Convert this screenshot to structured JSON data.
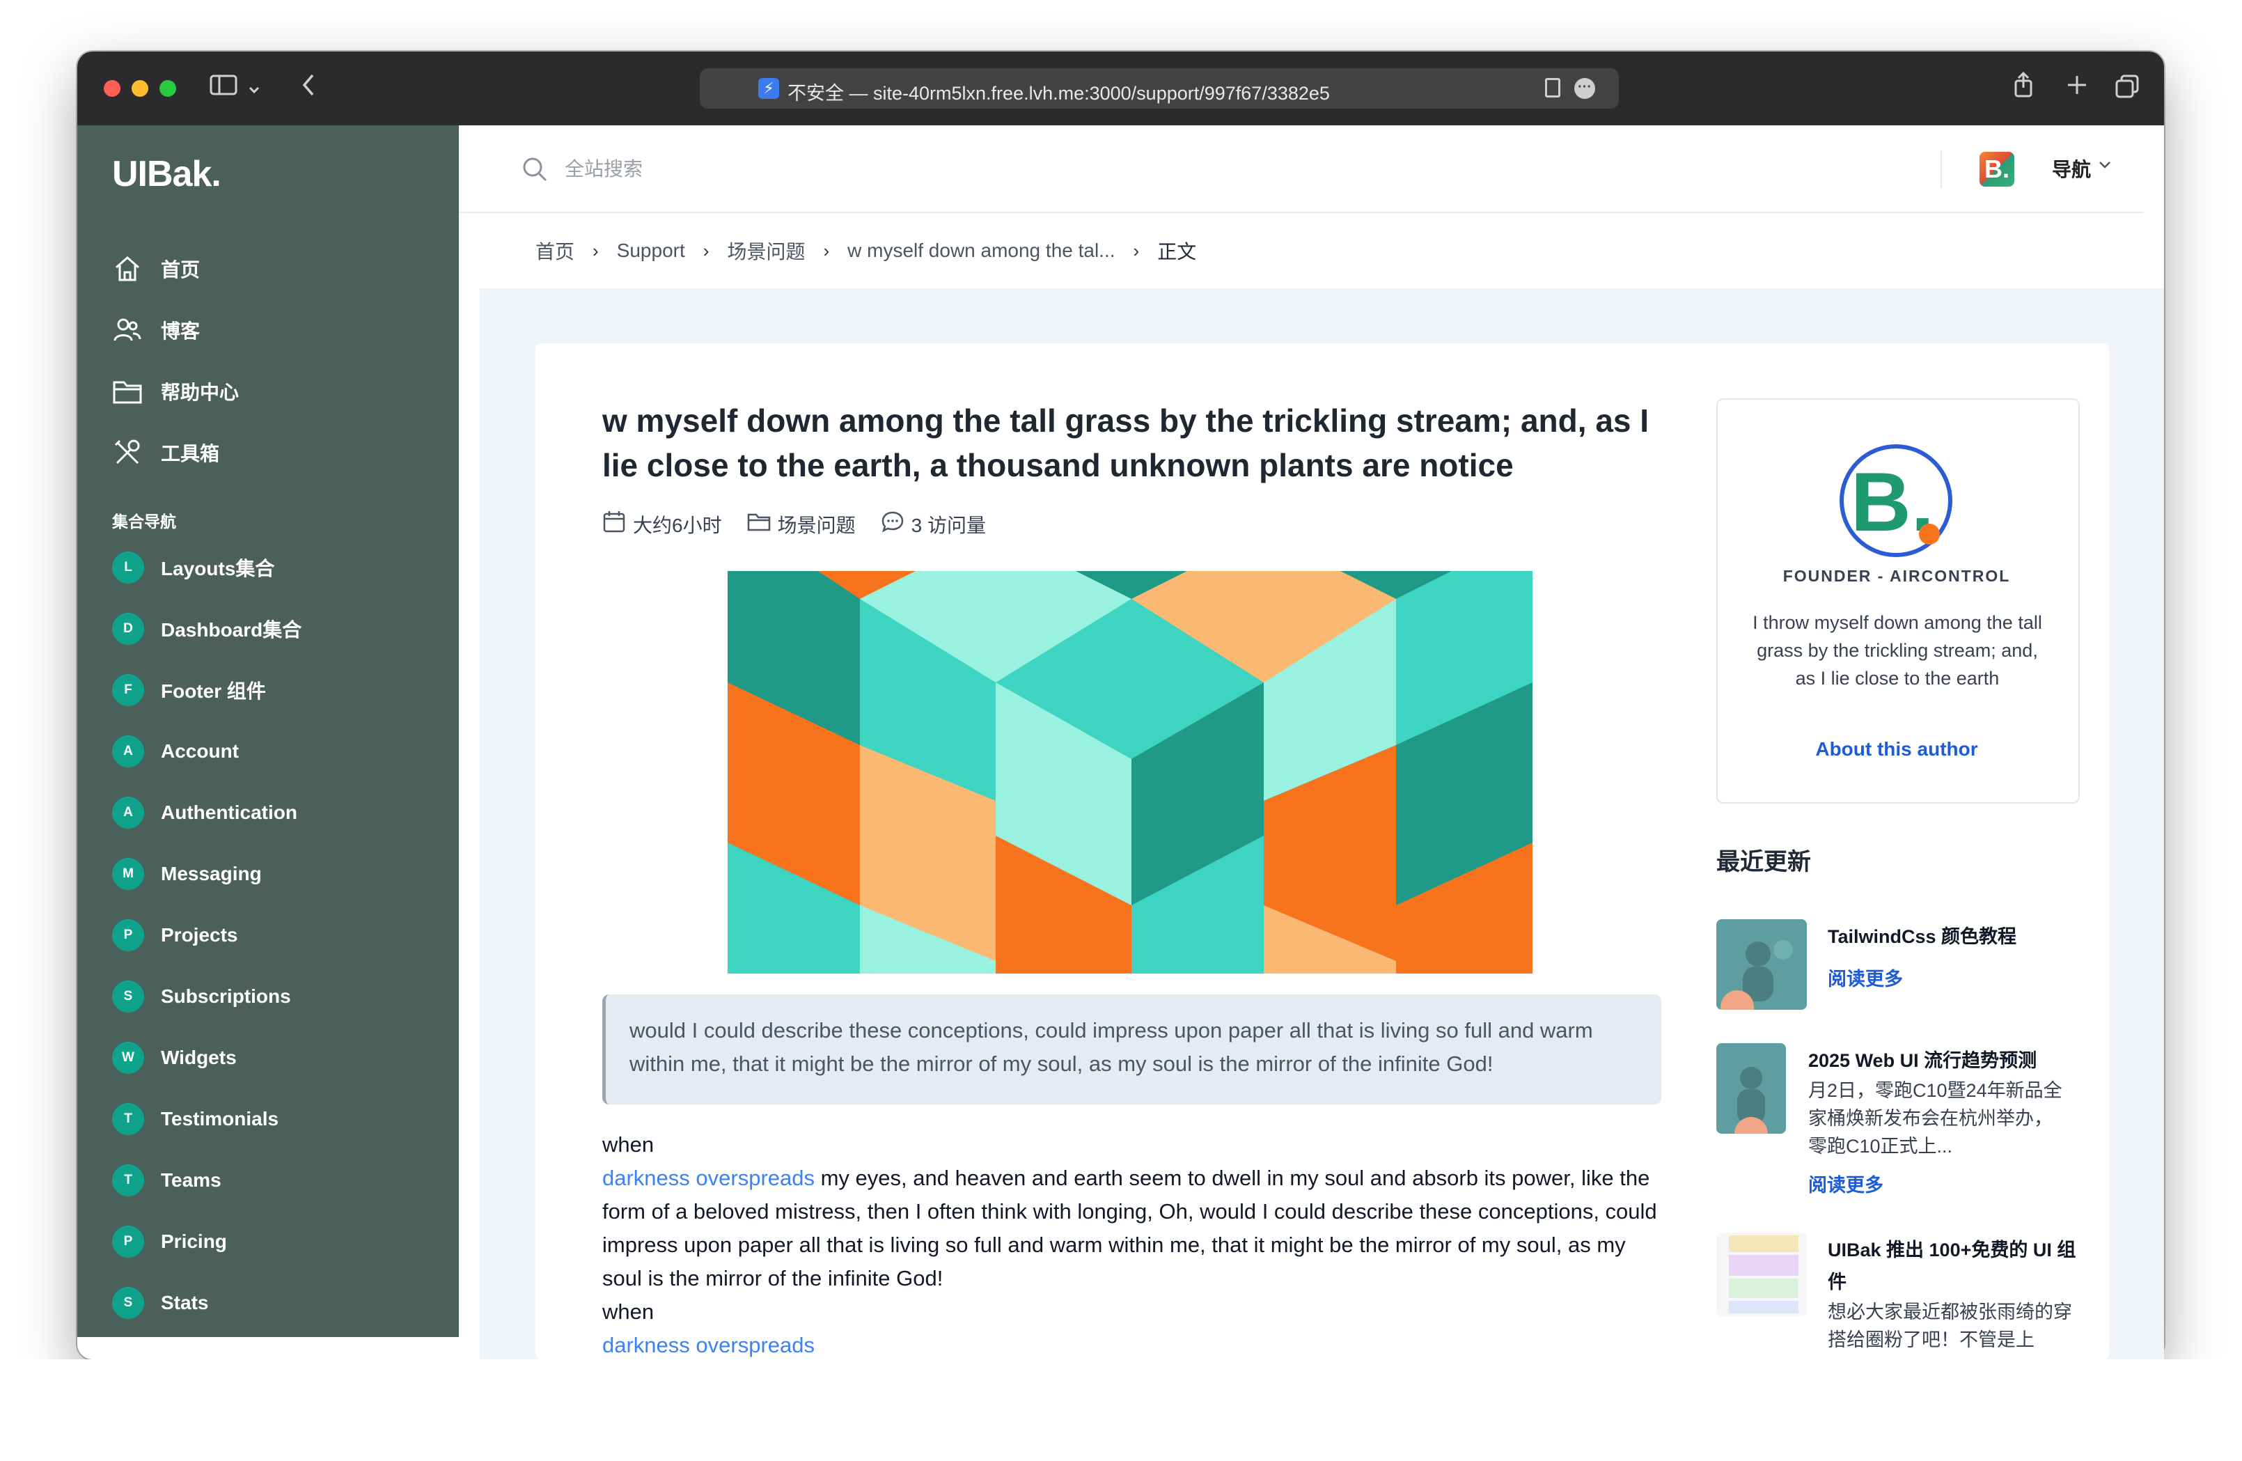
{
  "browser": {
    "url": "不安全 — site-40rm5lxn.free.lvh.me:3000/support/997f67/3382e5"
  },
  "sidebar": {
    "logo": "UIBak.",
    "nav": [
      {
        "label": "首页",
        "icon": "home-icon"
      },
      {
        "label": "博客",
        "icon": "users-icon"
      },
      {
        "label": "帮助中心",
        "icon": "folder-icon"
      },
      {
        "label": "工具箱",
        "icon": "tools-icon"
      }
    ],
    "section_title": "集合导航",
    "collections": [
      {
        "badge": "L",
        "label": "Layouts集合"
      },
      {
        "badge": "D",
        "label": "Dashboard集合"
      },
      {
        "badge": "F",
        "label": "Footer 组件"
      },
      {
        "badge": "A",
        "label": "Account"
      },
      {
        "badge": "A",
        "label": "Authentication"
      },
      {
        "badge": "M",
        "label": "Messaging"
      },
      {
        "badge": "P",
        "label": "Projects"
      },
      {
        "badge": "S",
        "label": "Subscriptions"
      },
      {
        "badge": "W",
        "label": "Widgets"
      },
      {
        "badge": "T",
        "label": "Testimonials"
      },
      {
        "badge": "T",
        "label": "Teams"
      },
      {
        "badge": "P",
        "label": "Pricing"
      },
      {
        "badge": "S",
        "label": "Stats"
      }
    ]
  },
  "header": {
    "search_placeholder": "全站搜索",
    "brand_letter": "B.",
    "nav_label": "导航"
  },
  "breadcrumbs": {
    "items": [
      "首页",
      "Support",
      "场景问题",
      "w myself down among the tal...",
      "正文"
    ]
  },
  "article": {
    "title": "w myself down among the tall grass by the trickling stream; and, as I lie close to the earth, a thousand unknown plants are notice",
    "meta": {
      "time": "大约6小时",
      "category": "场景问题",
      "views": "3 访问量"
    },
    "quote": "would I could describe these conceptions, could impress upon paper all that is living so full and warm within me, that it might be the mirror of my soul, as my soul is the mirror of the infinite God!",
    "body_when_1": "when",
    "body_link_1": "darkness overspreads",
    "body_para": " my eyes, and heaven and earth seem to dwell in my soul and absorb its power, like the form of a beloved mistress, then I often think with longing, Oh, would I could describe these conceptions, could impress upon paper all that is living so full and warm within me, that it might be the mirror of my soul, as my soul is the mirror of the infinite God!",
    "body_when_2": "when",
    "body_link_2": "darkness overspreads"
  },
  "author": {
    "avatar_letter": "B.",
    "role": "FOUNDER - AIRCONTROL",
    "bio": "I throw myself down among the tall grass by the trickling stream; and, as I lie close to the earth",
    "link": "About this author"
  },
  "recent": {
    "title": "最近更新",
    "items": [
      {
        "title": "TailwindCss 颜色教程",
        "excerpt": "",
        "link": "阅读更多"
      },
      {
        "title": "2025 Web UI 流行趋势预测",
        "excerpt": "月2日，零跑C10暨24年新品全家桶焕新发布会在杭州举办，零跑C10正式上...",
        "link": "阅读更多"
      },
      {
        "title": "UIBak 推出 100+免费的 UI 组件",
        "excerpt": "想必大家最近都被张雨绮的穿搭给圈粉了吧！不管是上",
        "link": ""
      }
    ]
  },
  "colors": {
    "sidebar_bg": "#4b5f5b",
    "badge": "#10a38b",
    "link": "#1d5cd6",
    "accent_blue": "#3b82f6"
  }
}
